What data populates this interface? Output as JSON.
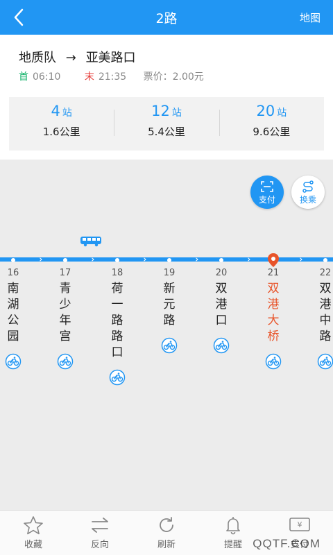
{
  "header": {
    "title": "2路",
    "map_label": "地图"
  },
  "route": {
    "from": "地质队",
    "arrow": "→",
    "to": "亚美路口",
    "first_label": "首",
    "first_time": "06:10",
    "last_label": "末",
    "last_time": "21:35",
    "price_label": "票价：",
    "price": "2.00元"
  },
  "stats": [
    {
      "count": "4",
      "unit": "站",
      "distance": "1.6公里"
    },
    {
      "count": "12",
      "unit": "站",
      "distance": "5.4公里"
    },
    {
      "count": "20",
      "unit": "站",
      "distance": "9.6公里"
    }
  ],
  "fabs": {
    "pay": "支付",
    "transfer": "换乘"
  },
  "stations": [
    {
      "num": "16",
      "name": "南湖公园",
      "bike": true,
      "current": false
    },
    {
      "num": "17",
      "name": "青少年宫",
      "bike": true,
      "current": false
    },
    {
      "num": "18",
      "name": "荷一路路口",
      "bike": true,
      "current": false
    },
    {
      "num": "19",
      "name": "新元路",
      "bike": true,
      "current": false
    },
    {
      "num": "20",
      "name": "双港口",
      "bike": true,
      "current": false
    },
    {
      "num": "21",
      "name": "双港大桥",
      "bike": true,
      "current": true
    },
    {
      "num": "22",
      "name": "双港中路",
      "bike": true,
      "current": false
    }
  ],
  "bottom_nav": [
    {
      "label": "收藏",
      "icon": "star-icon"
    },
    {
      "label": "反向",
      "icon": "swap-icon"
    },
    {
      "label": "刷新",
      "icon": "refresh-icon"
    },
    {
      "label": "提醒",
      "icon": "bell-icon"
    },
    {
      "label": "支付",
      "icon": "ticket-icon"
    }
  ],
  "watermark": "QQTF.COM",
  "colors": {
    "primary": "#2196f3",
    "current_station": "#e8542a",
    "first_label": "#15b36b",
    "last_label": "#e53935"
  }
}
